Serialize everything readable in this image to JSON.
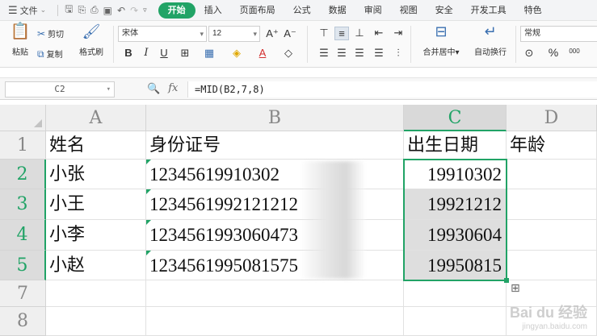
{
  "menubar": {
    "file_label": "文件",
    "tabs": [
      {
        "label": "开始",
        "active": true
      },
      {
        "label": "插入"
      },
      {
        "label": "页面布局"
      },
      {
        "label": "公式"
      },
      {
        "label": "数据"
      },
      {
        "label": "审阅"
      },
      {
        "label": "视图"
      },
      {
        "label": "安全"
      },
      {
        "label": "开发工具"
      },
      {
        "label": "特色"
      }
    ]
  },
  "ribbon": {
    "paste": "粘贴",
    "cut": "剪切",
    "copy": "复制",
    "format_painter": "格式刷",
    "font_name": "宋体",
    "font_size": "12",
    "merge_center": "合并居中",
    "wrap_text": "自动换行",
    "number_format": "常规",
    "percent": "%",
    "thousands": "000"
  },
  "formula_bar": {
    "name_box": "C2",
    "formula": "=MID(B2,7,8)"
  },
  "grid": {
    "columns": [
      "A",
      "B",
      "C",
      "D"
    ],
    "rows": [
      "1",
      "2",
      "3",
      "4",
      "5",
      "7",
      "8"
    ],
    "header_row": {
      "A": "姓名",
      "B": "身份证号",
      "C": "出生日期",
      "D": "年龄"
    },
    "data_rows": [
      {
        "name": "小张",
        "id": "12345619910302",
        "dob": "19910302"
      },
      {
        "name": "小王",
        "id": "1234561992121212",
        "dob": "19921212"
      },
      {
        "name": "小李",
        "id": "1234561993060473",
        "dob": "19930604"
      },
      {
        "name": "小赵",
        "id": "1234561995081575",
        "dob": "19950815"
      }
    ]
  },
  "watermark": {
    "text": "Bai du 经验",
    "sub": "jingyan.baidu.com"
  },
  "colors": {
    "accent": "#21a366"
  }
}
